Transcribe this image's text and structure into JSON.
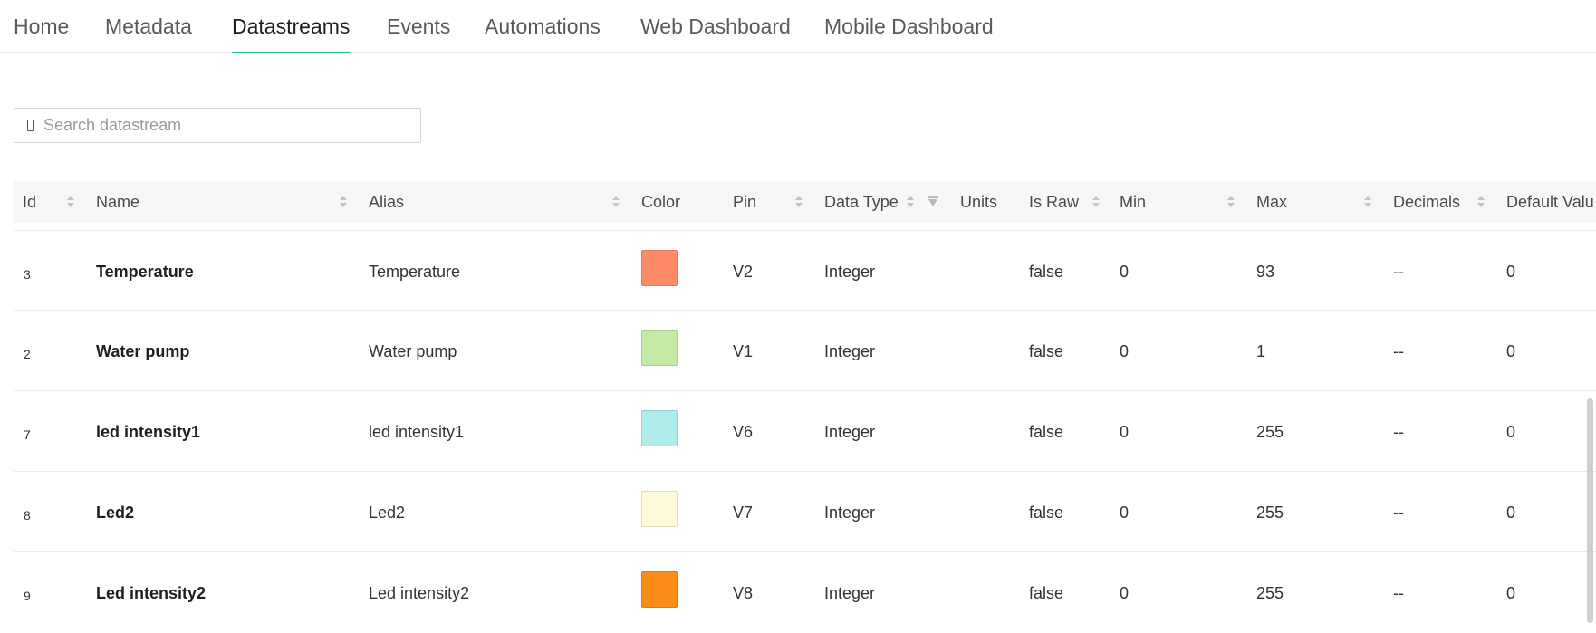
{
  "tabs": [
    {
      "label": "Home"
    },
    {
      "label": "Metadata"
    },
    {
      "label": "Datastreams",
      "active": true
    },
    {
      "label": "Events"
    },
    {
      "label": "Automations"
    },
    {
      "label": "Web Dashboard"
    },
    {
      "label": "Mobile Dashboard"
    }
  ],
  "search": {
    "placeholder": "Search datastream",
    "value": ""
  },
  "table": {
    "columns": [
      "Id",
      "Name",
      "Alias",
      "Color",
      "Pin",
      "Data Type",
      "Units",
      "Is Raw",
      "Min",
      "Max",
      "Decimals",
      "Default Valu"
    ],
    "rows": [
      {
        "id": "3",
        "name": "Temperature",
        "alias": "Temperature",
        "color": "#fd8b68",
        "pin": "V2",
        "data_type": "Integer",
        "units": "",
        "is_raw": "false",
        "min": "0",
        "max": "93",
        "decimals": "--",
        "default": "0"
      },
      {
        "id": "2",
        "name": "Water pump",
        "alias": "Water pump",
        "color": "#c3eaa6",
        "pin": "V1",
        "data_type": "Integer",
        "units": "",
        "is_raw": "false",
        "min": "0",
        "max": "1",
        "decimals": "--",
        "default": "0"
      },
      {
        "id": "7",
        "name": "led intensity1",
        "alias": "led intensity1",
        "color": "#b0ebec",
        "pin": "V6",
        "data_type": "Integer",
        "units": "",
        "is_raw": "false",
        "min": "0",
        "max": "255",
        "decimals": "--",
        "default": "0"
      },
      {
        "id": "8",
        "name": "Led2",
        "alias": "Led2",
        "color": "#fffad7",
        "pin": "V7",
        "data_type": "Integer",
        "units": "",
        "is_raw": "false",
        "min": "0",
        "max": "255",
        "decimals": "--",
        "default": "0"
      },
      {
        "id": "9",
        "name": "Led intensity2",
        "alias": "Led intensity2",
        "color": "#fb8c18",
        "pin": "V8",
        "data_type": "Integer",
        "units": "",
        "is_raw": "false",
        "min": "0",
        "max": "255",
        "decimals": "--",
        "default": "0"
      }
    ]
  },
  "icons": {
    "search": "search-icon",
    "sort": "sort-icon",
    "filter": "filter-icon"
  },
  "accent": "#23c48e"
}
